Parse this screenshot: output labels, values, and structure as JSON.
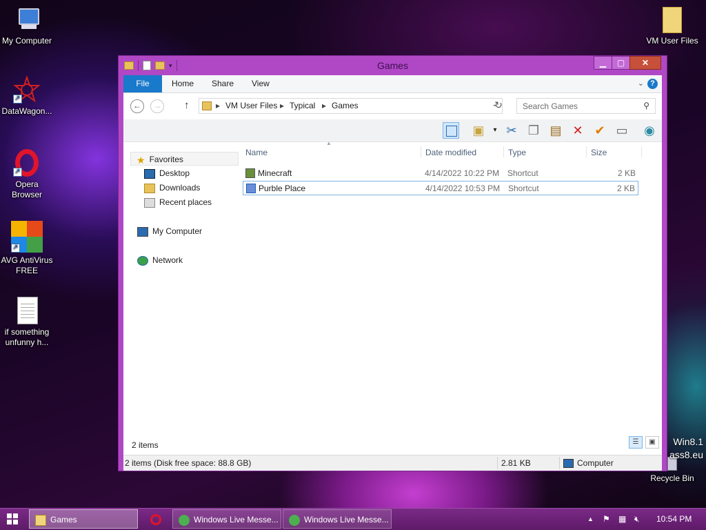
{
  "desktop": {
    "icons_left": [
      {
        "label": "My Computer",
        "icon": "computer-icon"
      },
      {
        "label": "DataWagon...",
        "icon": "datawagon-icon"
      },
      {
        "label": "Opera Browser",
        "icon": "opera-icon"
      },
      {
        "label": "AVG AntiVirus FREE",
        "icon": "avg-icon"
      },
      {
        "label": "if something unfunny h...",
        "icon": "text-file-icon"
      }
    ],
    "icons_right": [
      {
        "label": "VM User Files",
        "icon": "folder-icon"
      },
      {
        "label": "Recycle Bin",
        "icon": "recycle-bin-icon"
      }
    ],
    "watermark": [
      "Win8.1",
      "ass8.eu"
    ]
  },
  "window": {
    "title": "Games",
    "controls": {
      "minimize": "▁",
      "maximize": "▢",
      "close": "✕"
    },
    "ribbon": {
      "file_tab": "File",
      "tabs": [
        "Home",
        "Share",
        "View"
      ],
      "help": "?"
    },
    "address": {
      "breadcrumbs": [
        "VM User Files",
        "Typical",
        "Games"
      ],
      "search_placeholder": "Search Games"
    },
    "navigation": {
      "favorites_label": "Favorites",
      "favorites": [
        "Desktop",
        "Downloads",
        "Recent places"
      ],
      "computer": "My Computer",
      "network": "Network"
    },
    "columns": [
      "Name",
      "Date modified",
      "Type",
      "Size"
    ],
    "files": [
      {
        "name": "Minecraft",
        "date": "4/14/2022 10:22 PM",
        "type": "Shortcut",
        "size": "2 KB",
        "selected": false
      },
      {
        "name": "Purble Place",
        "date": "4/14/2022 10:53 PM",
        "type": "Shortcut",
        "size": "2 KB",
        "selected": true
      }
    ],
    "item_count": "2 items",
    "details": {
      "summary": "2 items (Disk free space: 88.8 GB)",
      "size": "2.81 KB",
      "location": "Computer"
    }
  },
  "taskbar": {
    "buttons": [
      {
        "label": "Games",
        "active": true
      },
      {
        "label": "",
        "icon": "opera-icon"
      },
      {
        "label": "Windows Live Messe...",
        "active": false
      },
      {
        "label": "Windows Live Messe...",
        "active": false
      }
    ],
    "clock": "10:54 PM",
    "tray_arrow": "▲"
  },
  "colors": {
    "window_frame": "#b048c6",
    "file_tab": "#1979ca",
    "selection_border": "#7bb4e3",
    "taskbar": "#6a2276"
  }
}
